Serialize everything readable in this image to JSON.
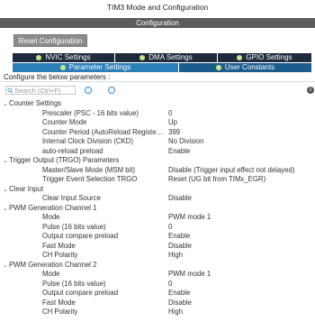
{
  "window": {
    "title": "TIM3 Mode and Configuration"
  },
  "config_bar": {
    "label": "Configuration"
  },
  "toolbar": {
    "reset_label": "Reset Configuration"
  },
  "tabs_row1": [
    {
      "label": "NVIC Settings"
    },
    {
      "label": "DMA Settings"
    },
    {
      "label": "GPIO Settings"
    }
  ],
  "tabs_row2": [
    {
      "label": "Parameter Settings"
    },
    {
      "label": "User Constants"
    }
  ],
  "info_text": "Configure the below parameters :",
  "search": {
    "placeholder": "Search (Ctrl+F)"
  },
  "groups": {
    "counter": {
      "title": "Counter Settings",
      "params": [
        {
          "name": "Prescaler (PSC - 16 bits value)",
          "value": "0"
        },
        {
          "name": "Counter Mode",
          "value": "Up"
        },
        {
          "name": "Counter Period (AutoReload Register - 1...",
          "value": "399"
        },
        {
          "name": "Internal Clock Division (CKD)",
          "value": "No Division"
        },
        {
          "name": "auto-reload preload",
          "value": "Enable"
        }
      ]
    },
    "trgo": {
      "title": "Trigger Output (TRGO) Parameters",
      "params": [
        {
          "name": "Master/Slave Mode (MSM bit)",
          "value": "Disable (Trigger input effect not delayed)"
        },
        {
          "name": "Trigger Event Selection TRGO",
          "value": "Reset (UG bit from TIMx_EGR)"
        }
      ]
    },
    "clear": {
      "title": "Clear Input",
      "params": [
        {
          "name": "Clear Input Source",
          "value": "Disable"
        }
      ]
    },
    "pwm1": {
      "title": "PWM Generation Channel 1",
      "params": [
        {
          "name": "Mode",
          "value": "PWM mode 1"
        },
        {
          "name": "Pulse (16 bits value)",
          "value": "0"
        },
        {
          "name": "Output compare preload",
          "value": "Enable"
        },
        {
          "name": "Fast Mode",
          "value": "Disable"
        },
        {
          "name": "CH Polarity",
          "value": "High"
        }
      ]
    },
    "pwm2": {
      "title": "PWM Generation Channel 2",
      "params": [
        {
          "name": "Mode",
          "value": "PWM mode 1"
        },
        {
          "name": "Pulse (16 bits value)",
          "value": "0"
        },
        {
          "name": "Output compare preload",
          "value": "Enable"
        },
        {
          "name": "Fast Mode",
          "value": "Disable"
        },
        {
          "name": "CH Polarity",
          "value": "High"
        }
      ]
    }
  },
  "colors": {
    "tab_dark": "#1d2b3c",
    "tab_active": "#2b7fb8",
    "status_dot": "#c6e58c",
    "header_bar": "#5c5c5c"
  }
}
